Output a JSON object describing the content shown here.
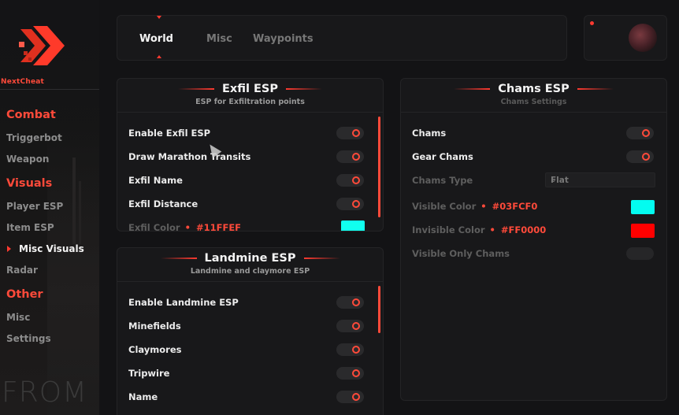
{
  "brand": {
    "name": "NextCheat"
  },
  "sidebar": {
    "categories": [
      {
        "label": "Combat",
        "items": [
          "Triggerbot",
          "Weapon"
        ]
      },
      {
        "label": "Visuals",
        "items": [
          "Player ESP",
          "Item ESP",
          "Misc Visuals",
          "Radar"
        ]
      },
      {
        "label": "Other",
        "items": [
          "Misc",
          "Settings"
        ]
      }
    ],
    "active_item": "Misc Visuals",
    "watermark": "FROM"
  },
  "tabs": [
    {
      "label": "World",
      "active": true
    },
    {
      "label": "Misc",
      "active": false
    },
    {
      "label": "Waypoints",
      "active": false
    }
  ],
  "exfil": {
    "title": "Exfil ESP",
    "subtitle": "ESP for Exfiltration points",
    "rows": [
      {
        "label": "Enable Exfil ESP",
        "on": true
      },
      {
        "label": "Draw Marathon Transits",
        "on": true
      },
      {
        "label": "Exfil Name",
        "on": true
      },
      {
        "label": "Exfil Distance",
        "on": true
      }
    ],
    "color_label": "Exfil Color",
    "color_hex": "#11FFEF",
    "color_value": "#11ffef"
  },
  "landmine": {
    "title": "Landmine ESP",
    "subtitle": "Landmine and claymore ESP",
    "rows": [
      {
        "label": "Enable Landmine ESP",
        "on": true
      },
      {
        "label": "Minefields",
        "on": true
      },
      {
        "label": "Claymores",
        "on": true
      },
      {
        "label": "Tripwire",
        "on": true
      },
      {
        "label": "Name",
        "on": true
      }
    ]
  },
  "chams": {
    "title": "Chams ESP",
    "subtitle": "Chams Settings",
    "rows": [
      {
        "label": "Chams",
        "on": true
      },
      {
        "label": "Gear Chams",
        "on": true
      }
    ],
    "type_label": "Chams Type",
    "type_value": "Flat",
    "visible_color_label": "Visible Color",
    "visible_color_hex": "#03FCF0",
    "visible_color_value": "#03fcf0",
    "invisible_color_label": "Invisible Color",
    "invisible_color_hex": "#FF0000",
    "invisible_color_value": "#ff0000",
    "visible_only_label": "Visible Only Chams",
    "visible_only_on": false
  },
  "colors": {
    "accent": "#ff4a3a"
  }
}
